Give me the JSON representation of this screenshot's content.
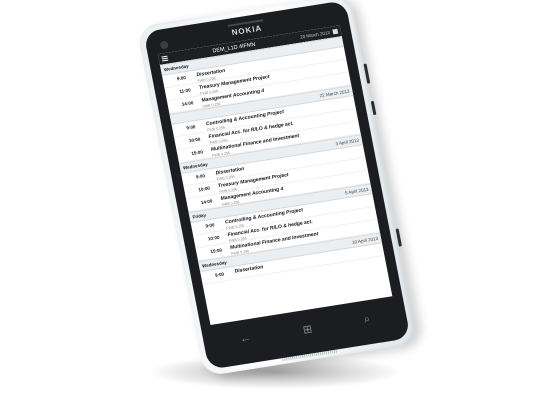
{
  "device": {
    "brand": "NOKIA"
  },
  "app": {
    "title": "DEM_L1D 4IFMN",
    "date": "20 March 2013"
  },
  "schedule": [
    {
      "type": "day",
      "label": "Wednesday",
      "date": ""
    },
    {
      "type": "item",
      "time": "9:00",
      "name": "Dissertation",
      "sub": "FWB 0.256"
    },
    {
      "type": "item",
      "time": "11:00",
      "name": "Treasury Management Project",
      "sub": "FWB 0.256"
    },
    {
      "type": "item",
      "time": "14:00",
      "name": "Management Accounting 4",
      "sub": "FWB 0.256"
    },
    {
      "type": "day",
      "label": "",
      "date": "22 March 2013"
    },
    {
      "type": "item",
      "time": "9:00",
      "name": "Controlling & Accounting Project",
      "sub": "FWB 0.256"
    },
    {
      "type": "item",
      "time": "10:00",
      "name": "Financial Acc. for R/LO & hedge act.",
      "sub": "FWB 0.256"
    },
    {
      "type": "item",
      "time": "15:00",
      "name": "Multinational Finance and Investment",
      "sub": "FWB 0.256"
    },
    {
      "type": "day",
      "label": "Wednesday",
      "date": "3 April 2013"
    },
    {
      "type": "item",
      "time": "9:00",
      "name": "Dissertation",
      "sub": "FWB 0.256"
    },
    {
      "type": "item",
      "time": "10:00",
      "name": "Treasury Management Project",
      "sub": "FWB 0.256"
    },
    {
      "type": "item",
      "time": "14:00",
      "name": "Management Accounting 4",
      "sub": "FWB 0.256"
    },
    {
      "type": "day",
      "label": "Friday",
      "date": "5 April 2013"
    },
    {
      "type": "item",
      "time": "9:00",
      "name": "Controlling & Accounting Project",
      "sub": "FWB 0.256"
    },
    {
      "type": "item",
      "time": "10:00",
      "name": "Financial Acc. for R/LO & hedge act.",
      "sub": "FWB 0.256"
    },
    {
      "type": "item",
      "time": "15:00",
      "name": "Multinational Finance and Investment",
      "sub": "FWB 0.256"
    },
    {
      "type": "day",
      "label": "Wednesday",
      "date": "10 April 2013"
    },
    {
      "type": "item",
      "time": "9:00",
      "name": "Dissertation",
      "sub": ""
    }
  ],
  "navbar": {
    "back": "←",
    "start": "⊞",
    "search": "⌕"
  }
}
